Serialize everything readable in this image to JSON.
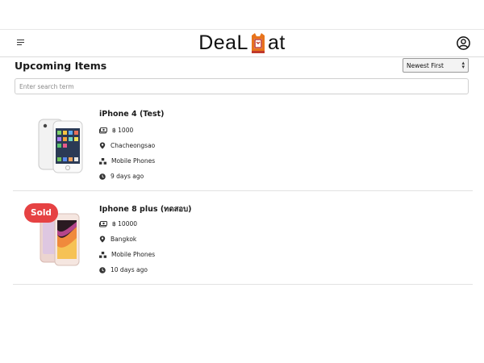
{
  "header": {
    "logo_left": "DeaL",
    "logo_right": "at",
    "colors": {
      "logo_mark": "#e8741c",
      "logo_mark_dark": "#c0392b"
    }
  },
  "toolbar": {
    "title": "Upcoming Items",
    "sort_value": "Newest First"
  },
  "search": {
    "placeholder": "Enter search term"
  },
  "items": [
    {
      "title": "iPhone 4 (Test)",
      "price": "฿ 1000",
      "location": "Chacheongsao",
      "category": "Mobile Phones",
      "age": "9 days ago",
      "sold": false
    },
    {
      "title": "Iphone 8 plus (ทดสอบ)",
      "price": "฿ 10000",
      "location": "Bangkok",
      "category": "Mobile Phones",
      "age": "10 days ago",
      "sold": true,
      "badge": "Sold"
    }
  ],
  "colors": {
    "sold_badge": "#e64243",
    "divider": "#e2e2e2"
  }
}
